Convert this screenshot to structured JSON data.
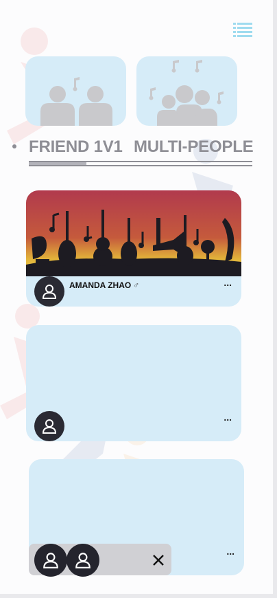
{
  "tabs": {
    "friend_label": "FRIEND 1V1",
    "multi_label": "MULTI-PEOPLE"
  },
  "rooms": [
    {
      "host_name": "AMANDA ZHAO",
      "gender_symbol": "♂",
      "more_label": "...",
      "banner": "music-instruments-banner"
    },
    {
      "host_name": "",
      "more_label": "..."
    },
    {
      "host_name": "",
      "more_label": "..."
    }
  ],
  "floating_bar": {
    "close_label": "×"
  },
  "icons": {
    "menu": "menu-icon",
    "avatar": "user-avatar-icon",
    "one_on_one": "two-people-music-icon",
    "multi": "group-music-icon"
  },
  "colors": {
    "card_bg": "#d6ecf8",
    "menu_accent": "#9fdbef",
    "tab_text": "#8e8e95",
    "avatar_bg": "#2a2a33"
  }
}
